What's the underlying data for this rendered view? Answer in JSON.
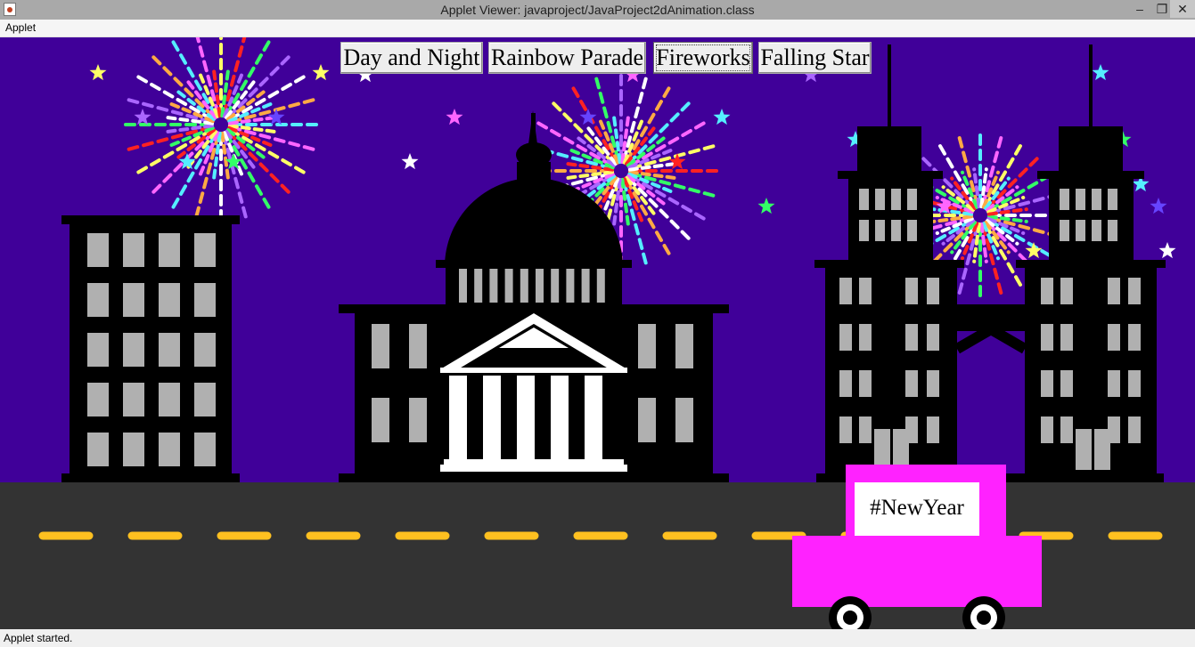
{
  "window": {
    "title": "Applet Viewer: javaproject/JavaProject2dAnimation.class",
    "minimize_glyph": "–",
    "maximize_glyph": "❐",
    "close_glyph": "✕"
  },
  "menu": {
    "items": [
      {
        "label": "Applet"
      }
    ]
  },
  "status": {
    "text": "Applet started."
  },
  "buttons": [
    {
      "label": "Day and Night",
      "active": false
    },
    {
      "label": "Rainbow Parade",
      "active": false
    },
    {
      "label": "Fireworks",
      "active": true
    },
    {
      "label": "Falling Star",
      "active": false
    }
  ],
  "car": {
    "sign_text": "#NewYear",
    "color": "#ff22ff"
  },
  "colors": {
    "sky": "#400099",
    "road": "#333333",
    "lane": "#ffc020",
    "building": "#000000",
    "window": "#b0b0b0",
    "facade": "#ffffff"
  },
  "firework_colors": [
    "#55eeff",
    "#ff66ff",
    "#ffff66",
    "#ff2222",
    "#33ff66",
    "#aa66ff",
    "#ffffff",
    "#ffaa44"
  ]
}
